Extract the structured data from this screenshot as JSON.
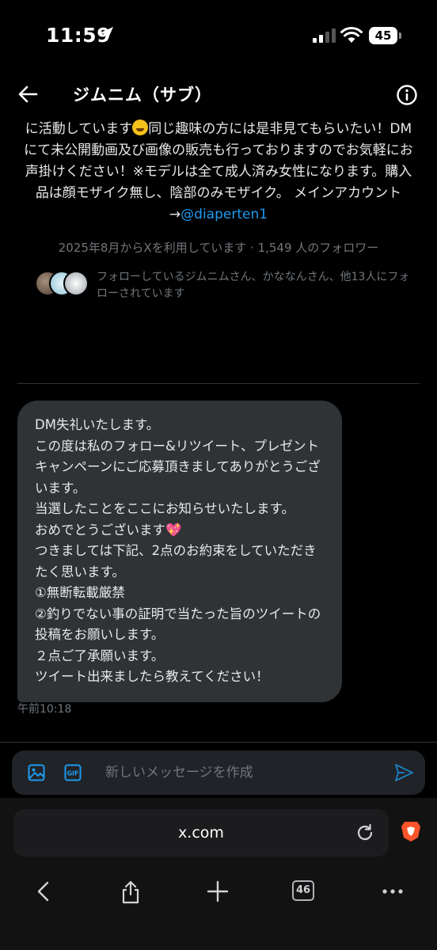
{
  "status": {
    "time": "11:59",
    "battery": "45"
  },
  "header": {
    "title": "ジムニム（サブ）"
  },
  "profile": {
    "bio_before_emoji": "に活動しています",
    "bio_after_emoji": "同じ趣味の方には是非見てもらいたい！DMにて未公開動画及び画像の販売も行っておりますのでお気軽にお声掛けください！※モデルは全て成人済み女性になります。購入品は顔モザイク無し、陰部のみモザイク。 メインアカウント→",
    "mention": "@diaperten1",
    "joined": "2025年8月からXを利用しています · 1,549 人のフォロワー",
    "followed_by": "フォローしているジムニムさん、かななんさん、他13人にフォローされています"
  },
  "message": {
    "lines": [
      "DM失礼いたします。",
      "この度は私のフォロー&リツイート、プレゼントキャンペーンにご応募頂きましてありがとうございます。",
      "当選したことをここにお知らせいたします。",
      "おめでとうございます💖",
      "つきましては下記、2点のお約束をしていただきたく思います。",
      "①無断転載厳禁",
      "②釣りでない事の証明で当たった旨のツイートの投稿をお願いします。",
      "２点ご了承願います。",
      "ツイート出来ましたら教えてください！"
    ],
    "time": "午前10:18"
  },
  "compose": {
    "placeholder": "新しいメッセージを作成"
  },
  "browser": {
    "url": "x.com",
    "tab_count": "46"
  },
  "colors": {
    "accent": "#1d9bf0",
    "bubble": "#2f3336",
    "muted": "#71767b",
    "brave": "#fb542b"
  },
  "icons": [
    "location-arrow-icon",
    "signal-icon",
    "wifi-icon",
    "battery-icon",
    "back-arrow-icon",
    "info-icon",
    "image-icon",
    "gif-icon",
    "send-icon",
    "reload-icon",
    "brave-lion-icon",
    "chevron-left-icon",
    "share-icon",
    "plus-icon",
    "tabs-icon",
    "more-icon"
  ]
}
